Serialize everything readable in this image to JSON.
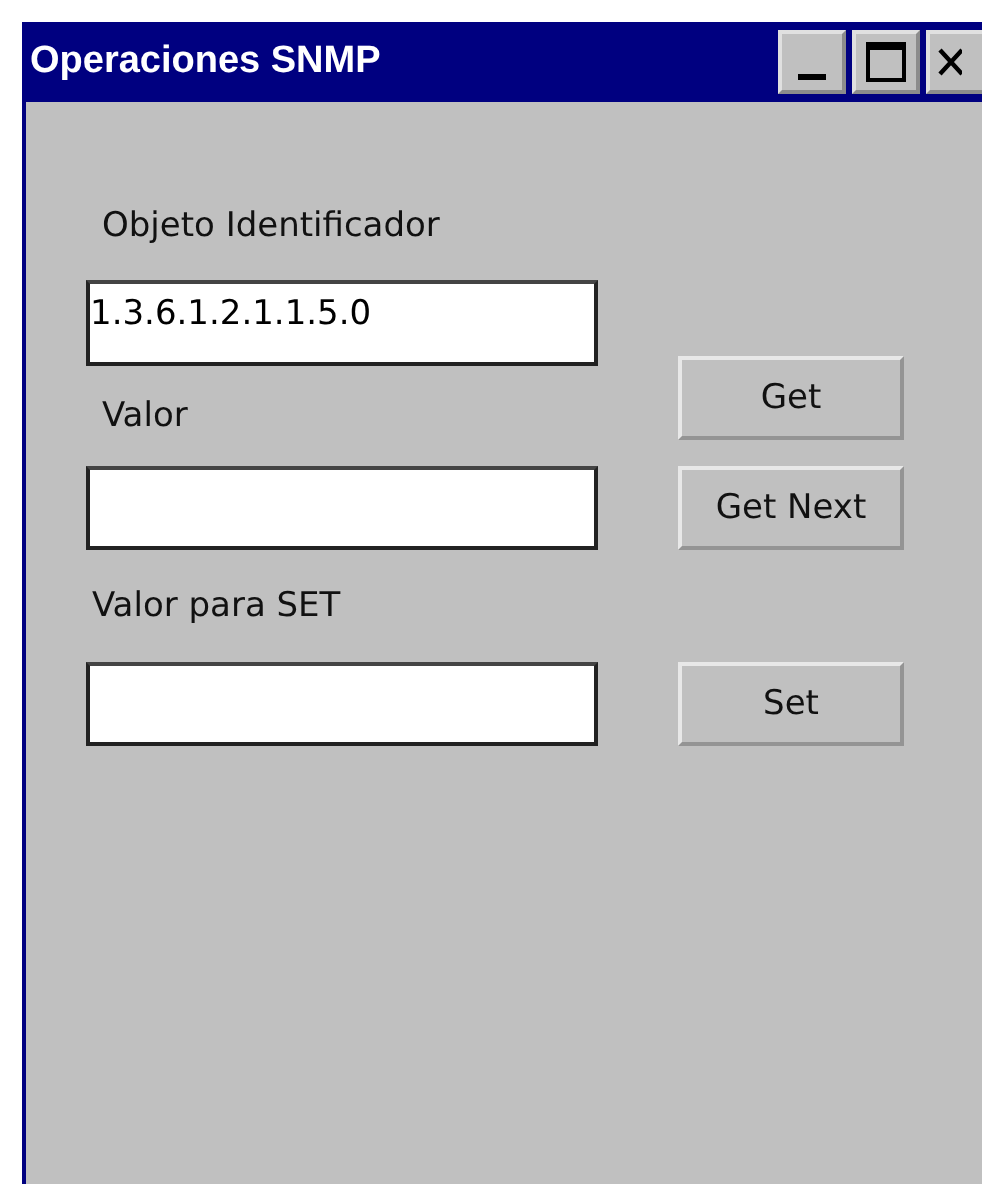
{
  "window": {
    "title": "Operaciones SNMP"
  },
  "fields": [
    {
      "label": "Objeto Identificador",
      "value": "1.3.6.1.2.1.1.5.0"
    },
    {
      "label": "Valor"
    },
    {
      "label": "Valor para SET"
    }
  ],
  "buttons": [
    "Get",
    "Get Next",
    "Set"
  ]
}
